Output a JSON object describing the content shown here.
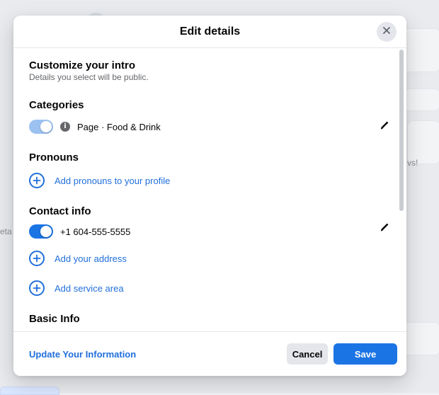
{
  "colors": {
    "accent": "#216fdb",
    "primary_button": "#1b74e4",
    "toggle_on": "#1b74e4",
    "toggle_disabled": "#9cc2f2"
  },
  "background": {
    "left_fragment_text": "eta",
    "right_fragment_text": "vs!"
  },
  "modal": {
    "title": "Edit details",
    "close_icon": "close-icon",
    "intro": {
      "title": "Customize your intro",
      "subtitle": "Details you select will be public."
    },
    "categories": {
      "title": "Categories",
      "toggle_on": true,
      "toggle_disabled": true,
      "info_icon": "info-icon",
      "value": "Page · Food & Drink",
      "edit_icon": "pencil-icon"
    },
    "pronouns": {
      "title": "Pronouns",
      "add_label": "Add pronouns to your profile",
      "add_icon": "plus-circle-icon"
    },
    "contact": {
      "title": "Contact info",
      "phone_toggle_on": true,
      "phone": "+1 604-555-5555",
      "edit_icon": "pencil-icon",
      "add_address_label": "Add your address",
      "add_service_area_label": "Add service area",
      "add_icon": "plus-circle-icon"
    },
    "basic_info": {
      "title": "Basic Info"
    },
    "footer": {
      "update_link": "Update Your Information",
      "cancel_label": "Cancel",
      "save_label": "Save"
    }
  }
}
